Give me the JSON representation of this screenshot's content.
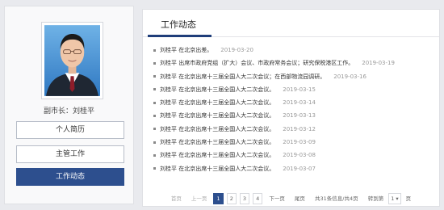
{
  "sidebar": {
    "role": "副市长：",
    "name": "刘桂平",
    "menu": [
      {
        "label": "个人简历"
      },
      {
        "label": "主管工作"
      },
      {
        "label": "工作动态"
      }
    ]
  },
  "main": {
    "title": "工作动态",
    "news": [
      {
        "title": "刘桂平 在北京出差。",
        "date": "2019-03-20"
      },
      {
        "title": "刘桂平 出席市政府党组（扩大）会议、市政府常务会议；研究保税港区工作。",
        "date": "2019-03-19"
      },
      {
        "title": "刘桂平 在北京出席十三届全国人大二次会议；在西部物流园调研。",
        "date": "2019-03-16"
      },
      {
        "title": "刘桂平 在北京出席十三届全国人大二次会议。",
        "date": "2019-03-15"
      },
      {
        "title": "刘桂平 在北京出席十三届全国人大二次会议。",
        "date": "2019-03-14"
      },
      {
        "title": "刘桂平 在北京出席十三届全国人大二次会议。",
        "date": "2019-03-13"
      },
      {
        "title": "刘桂平 在北京出席十三届全国人大二次会议。",
        "date": "2019-03-12"
      },
      {
        "title": "刘桂平 在北京出席十三届全国人大二次会议。",
        "date": "2019-03-09"
      },
      {
        "title": "刘桂平 在北京出席十三届全国人大二次会议。",
        "date": "2019-03-08"
      },
      {
        "title": "刘桂平 在北京出席十三届全国人大二次会议。",
        "date": "2019-03-07"
      }
    ],
    "pagination": {
      "first": "首页",
      "prev": "上一页",
      "pages": [
        "1",
        "2",
        "3",
        "4"
      ],
      "current_page": "1",
      "next": "下一页",
      "last": "尾页",
      "summary": "共31条信息/共4页",
      "goto_label": "转到第",
      "goto_value": "1",
      "goto_suffix": "页"
    }
  }
}
